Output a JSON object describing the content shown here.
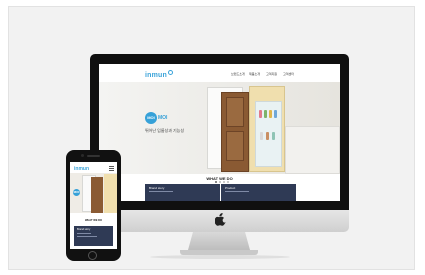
{
  "site": {
    "logo": "inmun",
    "nav": [
      "브랜드소개",
      "제품소개",
      "고객지원",
      "고객센터"
    ],
    "hero_badge": "MOI",
    "hero_badge_text": "MOI",
    "hero_subtitle": "뛰어난 임룸성과 기능성",
    "section_title": "WHAT WE DO",
    "cards": [
      "Brand story",
      "Product"
    ]
  },
  "mobile": {
    "logo": "inmun",
    "badge": "MOI",
    "section_title": "WHAT WE DO",
    "card_label": "Brand story"
  },
  "colors": {
    "accent": "#36a1d8",
    "card_bg": "#2f3a55"
  },
  "icons": [
    "apple-logo-icon",
    "hamburger-menu-icon",
    "home-button-icon"
  ]
}
